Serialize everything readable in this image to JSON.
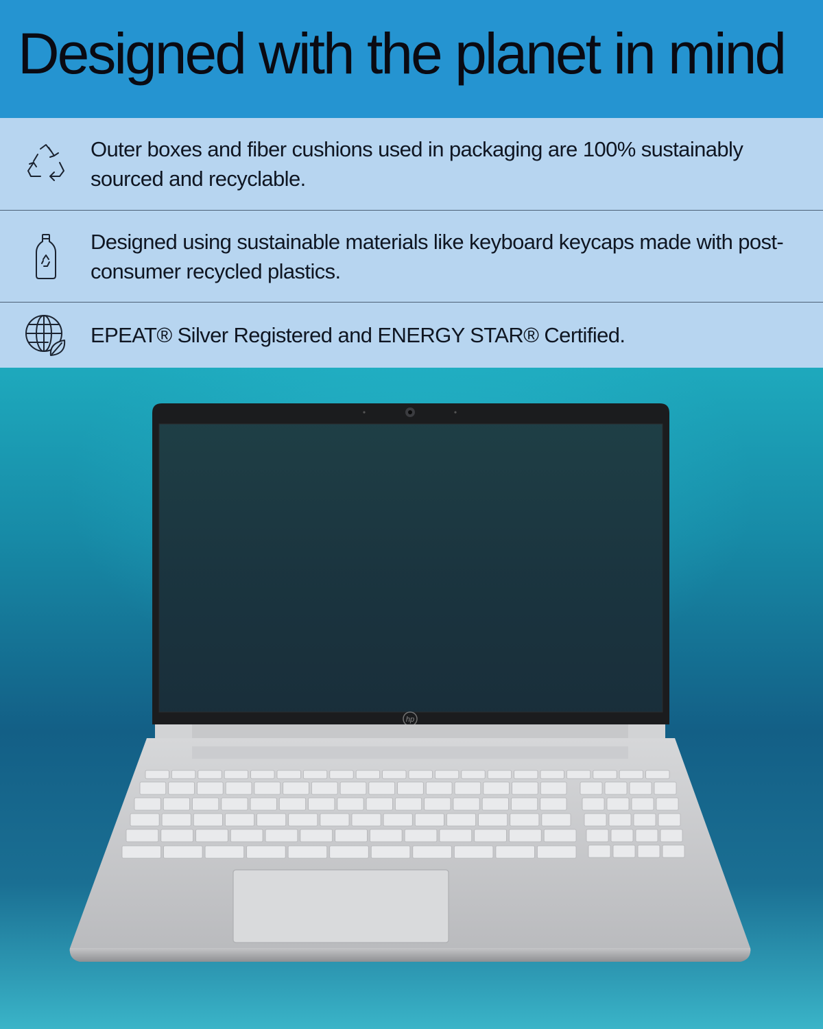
{
  "header": {
    "title": "Designed with the planet in mind"
  },
  "features": [
    {
      "icon": "recycle-icon",
      "text": "Outer boxes and fiber cushions used in packaging are 100% sustainably sourced and recyclable."
    },
    {
      "icon": "recycled-bottle-icon",
      "text": "Designed using sustainable materials like keyboard keycaps made with post-consumer recycled plastics."
    },
    {
      "icon": "globe-leaf-icon",
      "text": "EPEAT® Silver Registered and ENERGY STAR® Certified."
    }
  ],
  "laptop": {
    "logo": "hp"
  },
  "colors": {
    "header_bg": "#2594d1",
    "features_bg": "#b7d5f0",
    "divider": "#4b5f75",
    "text": "#0f1622"
  }
}
